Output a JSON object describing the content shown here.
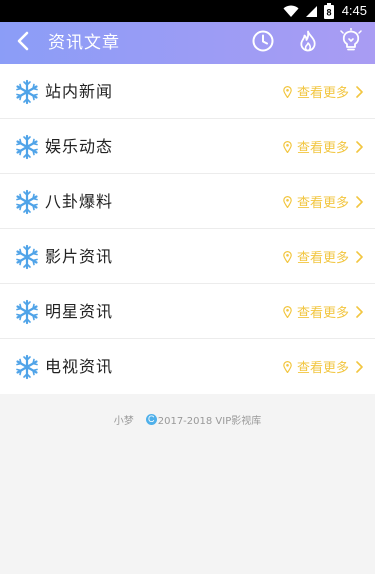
{
  "status_bar": {
    "time": "4:45",
    "battery_level": "8"
  },
  "header": {
    "title": "资讯文章",
    "icons": [
      "back-icon",
      "clock-icon",
      "flame-icon",
      "lightbulb-icon"
    ]
  },
  "categories": [
    {
      "label": "站内新闻",
      "more": "查看更多"
    },
    {
      "label": "娱乐动态",
      "more": "查看更多"
    },
    {
      "label": "八卦爆料",
      "more": "查看更多"
    },
    {
      "label": "影片资讯",
      "more": "查看更多"
    },
    {
      "label": "明星资讯",
      "more": "查看更多"
    },
    {
      "label": "电视资讯",
      "more": "查看更多"
    }
  ],
  "footer": {
    "author": "小梦",
    "copyright_symbol": "C",
    "text": "2017-2018 VIP影视库"
  },
  "colors": {
    "header_gradient_start": "#8b9df7",
    "header_gradient_end": "#a99cf3",
    "more_link": "#f2c640",
    "snowflake": "#4fa3e8",
    "page_background": "#f4f4f4"
  }
}
